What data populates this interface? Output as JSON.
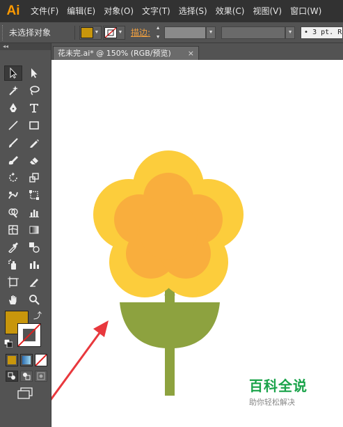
{
  "app": {
    "logo": "Ai"
  },
  "menu": [
    "文件(F)",
    "编辑(E)",
    "对象(O)",
    "文字(T)",
    "选择(S)",
    "效果(C)",
    "视图(V)",
    "窗口(W)"
  ],
  "control_bar": {
    "selection_label": "未选择对象",
    "fill_color": "#c8960c",
    "stroke_label": "描边:",
    "brush_definition": "• 3 pt. R"
  },
  "toolbar": {
    "collapse_glyph": "◂◂",
    "fill_color": "#c8960c"
  },
  "document_tab": {
    "title": "花未完.ai* @ 150% (RGB/预览)",
    "close": "×"
  },
  "artwork": {
    "petal_outer_color": "#fccd3c",
    "petal_inner_color": "#f9ae3d",
    "leaf_color": "#8da23f"
  },
  "watermark": {
    "title": "百科全说",
    "subtitle": "助你轻松解决"
  }
}
